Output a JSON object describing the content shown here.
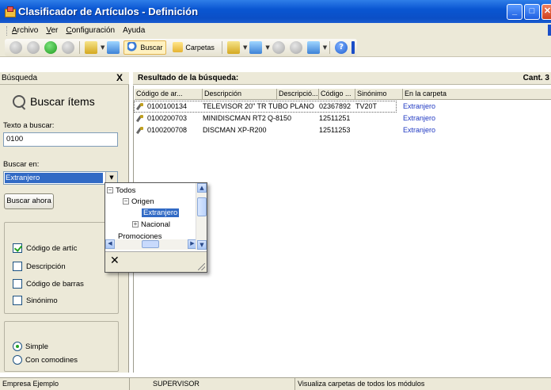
{
  "window": {
    "title": "Clasificador de Artículos - Definición"
  },
  "menu": {
    "items": [
      {
        "label": "Archivo",
        "mnemonic": "A",
        "rest": "rchivo"
      },
      {
        "label": "Ver",
        "mnemonic": "V",
        "rest": "er"
      },
      {
        "label": "Configuración",
        "mnemonic": "C",
        "rest": "onfiguración"
      },
      {
        "label": "Ayuda",
        "mnemonic": "",
        "rest": "Ayuda"
      }
    ]
  },
  "toolbar": {
    "buscar_label": "Buscar",
    "carpetas_label": "Carpetas",
    "icons": [
      "back-icon",
      "forward-icon",
      "refresh-icon",
      "stop-icon",
      "new-item-icon",
      "find-icon",
      "folders-icon",
      "grid-icon",
      "function-icon",
      "filter-icon",
      "tree-icon",
      "view-icon",
      "help-icon"
    ]
  },
  "search_pane": {
    "header": "Búsqueda",
    "close_glyph": "X",
    "title": "Buscar ítems",
    "text_label": "Texto a buscar:",
    "text_value": "0100",
    "search_in_label": "Buscar en:",
    "search_in_value": "Extranjero",
    "search_now": "Buscar ahora",
    "checkboxes": [
      {
        "label": "Código de artíc",
        "checked": true
      },
      {
        "label": "Descripción",
        "checked": false
      },
      {
        "label": "Código de barras",
        "checked": false
      },
      {
        "label": "Sinónimo",
        "checked": false
      }
    ],
    "radios": [
      {
        "label": "Simple",
        "selected": true
      },
      {
        "label": "Con comodines",
        "selected": false
      }
    ]
  },
  "tree_popup": {
    "nodes": [
      {
        "label": "Todos",
        "toggle": "−"
      },
      {
        "label": "Origen",
        "toggle": "−"
      },
      {
        "label": "Extranjero",
        "toggle": "",
        "selected": true
      },
      {
        "label": "Nacional",
        "toggle": "+"
      },
      {
        "label": "Promociones",
        "toggle": ""
      }
    ],
    "close_glyph": "✕"
  },
  "results": {
    "header": "Resultado de la búsqueda:",
    "count_label": "Cant. 3",
    "columns": [
      "Código de ar...",
      "Descripción",
      "Descripció...",
      "Código ...",
      "Sinónimo",
      "En la carpeta"
    ],
    "rows": [
      {
        "codigo": "0100100134",
        "descripcion": "TELEVISOR 20\" TR TUBO PLANO",
        "descripcion2": "",
        "codigo2": "02367892",
        "sinonimo": "TV20T",
        "carpeta": "Extranjero"
      },
      {
        "codigo": "0100200703",
        "descripcion": "MINIDISCMAN RT2",
        "descripcion2": "Q-8150",
        "codigo2": "12511251",
        "sinonimo": "",
        "carpeta": "Extranjero"
      },
      {
        "codigo": "0100200708",
        "descripcion": "DISCMAN XP-R200",
        "descripcion2": "",
        "codigo2": "12511253",
        "sinonimo": "",
        "carpeta": "Extranjero"
      }
    ]
  },
  "statusbar": {
    "company": "Empresa Ejemplo",
    "user": "SUPERVISOR",
    "message": "Visualiza carpetas de todos los módulos"
  }
}
